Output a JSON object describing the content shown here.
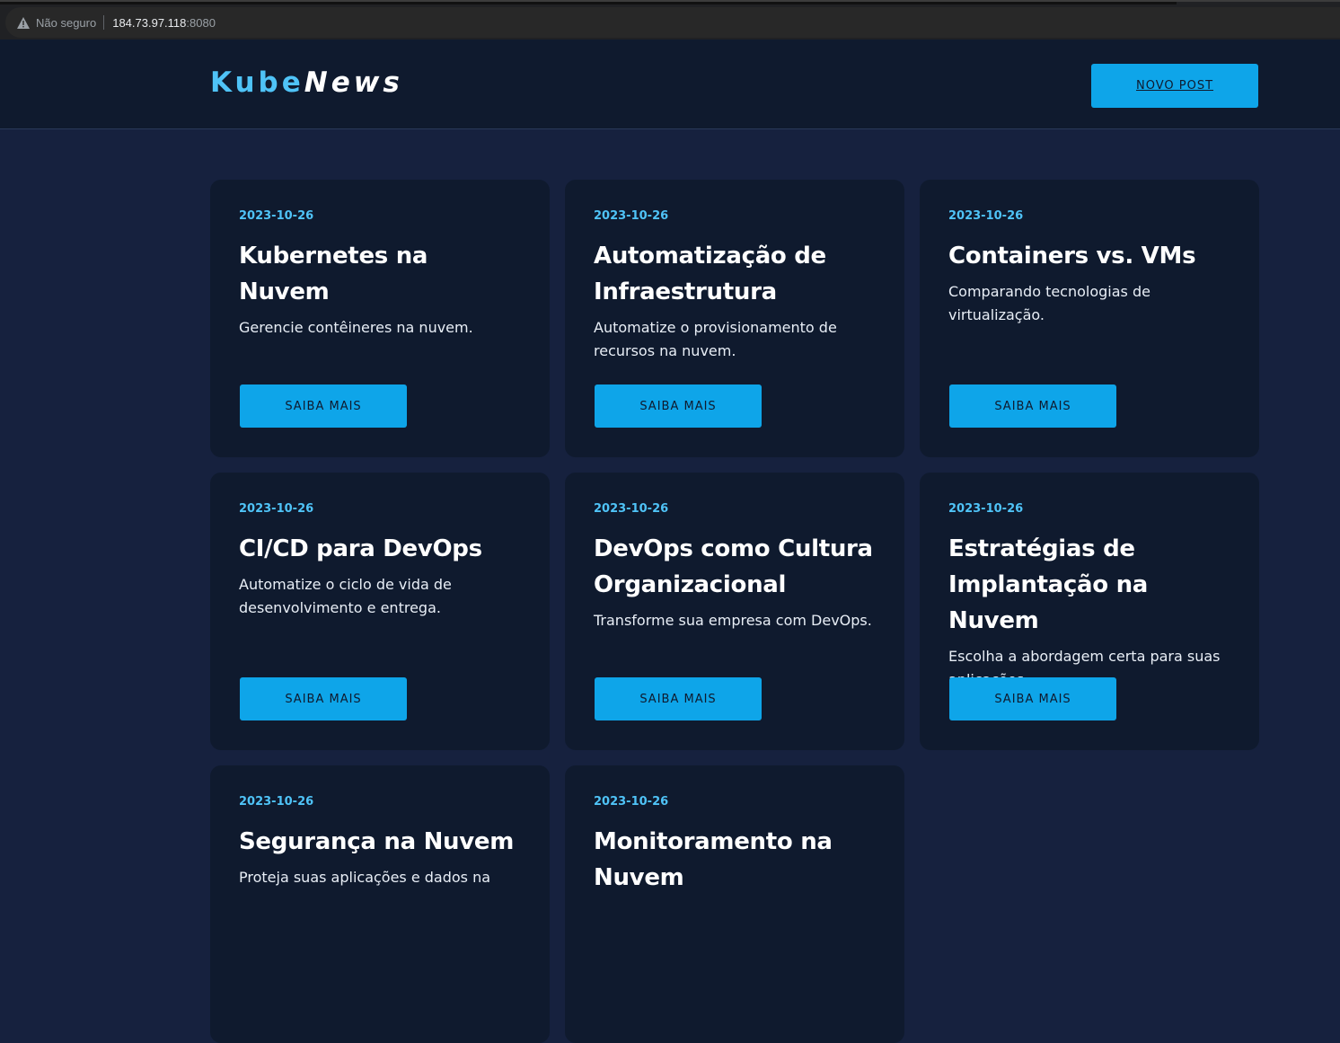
{
  "browser": {
    "security_label": "Não seguro",
    "url_host": "184.73.97.118",
    "url_port": ":8080"
  },
  "header": {
    "logo_part1": "Kube",
    "logo_part2": "News",
    "new_post_label": "NOVO POST"
  },
  "posts": [
    {
      "date": "2023-10-26",
      "title": "Kubernetes na Nuvem",
      "description": "Gerencie contêineres na nuvem.",
      "button": "SAIBA MAIS"
    },
    {
      "date": "2023-10-26",
      "title": "Automatização de Infraestrutura",
      "description": "Automatize o provisionamento de recursos na nuvem.",
      "button": "SAIBA MAIS"
    },
    {
      "date": "2023-10-26",
      "title": "Containers vs. VMs",
      "description": "Comparando tecnologias de virtualização.",
      "button": "SAIBA MAIS"
    },
    {
      "date": "2023-10-26",
      "title": "CI/CD para DevOps",
      "description": "Automatize o ciclo de vida de desenvolvimento e entrega.",
      "button": "SAIBA MAIS"
    },
    {
      "date": "2023-10-26",
      "title": "DevOps como Cultura Organizacional",
      "description": "Transforme sua empresa com DevOps.",
      "button": "SAIBA MAIS"
    },
    {
      "date": "2023-10-26",
      "title": "Estratégias de Implantação na Nuvem",
      "description": "Escolha a abordagem certa para suas aplicações.",
      "button": "SAIBA MAIS"
    },
    {
      "date": "2023-10-26",
      "title": "Segurança na Nuvem",
      "description": "Proteja suas aplicações e dados na",
      "button": ""
    },
    {
      "date": "2023-10-26",
      "title": "Monitoramento na Nuvem",
      "description": "",
      "button": ""
    }
  ],
  "colors": {
    "accent": "#0ea5e9",
    "date": "#4fc3f7",
    "page_bg": "#16213e",
    "card_bg": "#0f1a2e"
  }
}
